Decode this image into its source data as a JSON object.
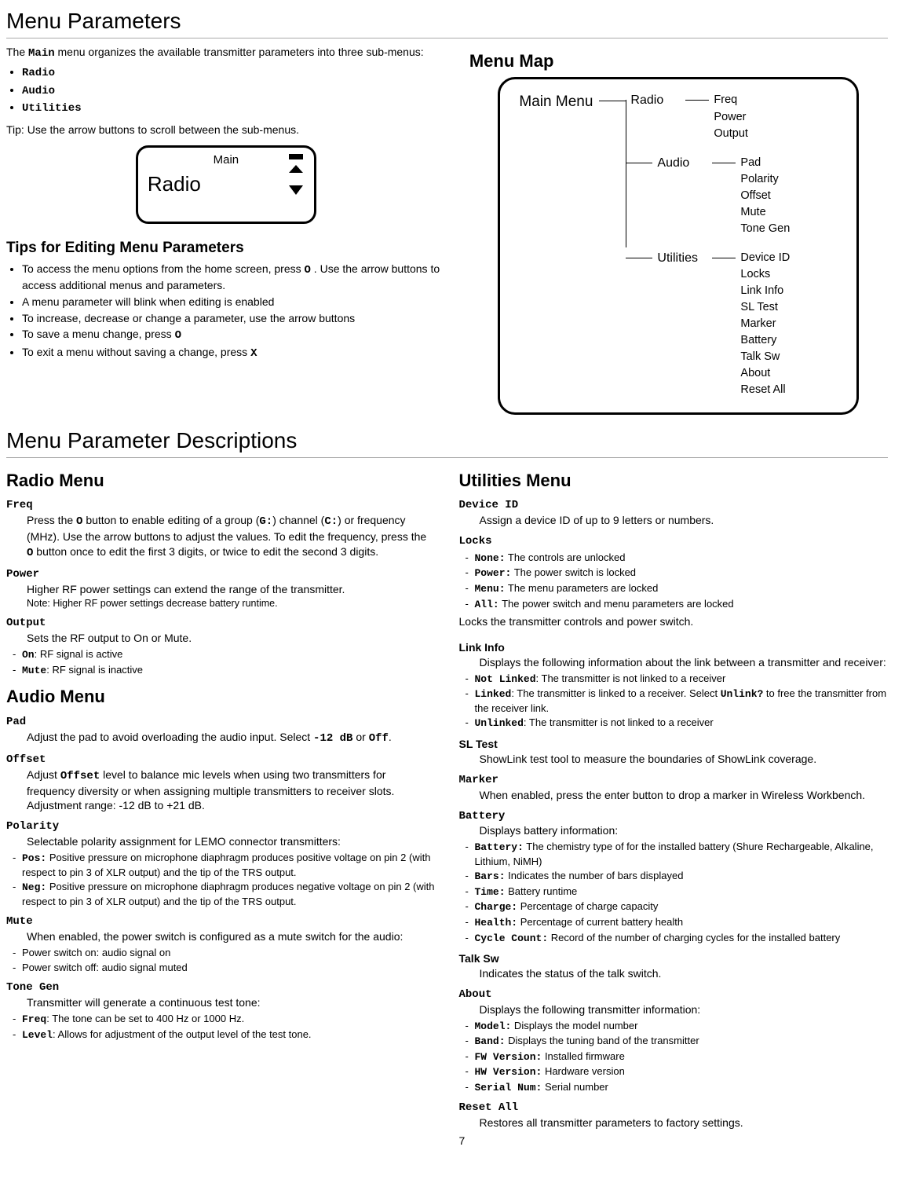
{
  "page_number": "7",
  "top": {
    "heading": "Menu Parameters",
    "intro_a": "The ",
    "intro_b": " menu organizes the available transmitter parameters into three sub-menus:",
    "main_word": "Main",
    "bullets": [
      "Radio",
      "Audio",
      "Utilities"
    ],
    "tip": "Tip: Use the arrow buttons to scroll between the sub-menus.",
    "lcd_top": "Main",
    "lcd_big": "Radio",
    "tips_heading": "Tips for Editing Menu Parameters",
    "tips": [
      {
        "a": "To access the menu options from the home screen, press ",
        "code": "O",
        "b": " . Use the arrow buttons to access additional menus and parameters."
      },
      {
        "a": "A menu parameter will blink when editing is enabled",
        "code": "",
        "b": ""
      },
      {
        "a": "To increase, decrease or change a parameter, use the arrow buttons",
        "code": "",
        "b": ""
      },
      {
        "a": "To save a menu change, press ",
        "code": "O",
        "b": ""
      },
      {
        "a": "To exit a menu without saving a change, press ",
        "code": "X",
        "b": ""
      }
    ],
    "map_heading": "Menu Map",
    "map": {
      "root": "Main Menu",
      "nodes": [
        {
          "label": "Radio",
          "items": [
            "Freq",
            "Power",
            "Output"
          ]
        },
        {
          "label": "Audio",
          "items": [
            "Pad",
            "Polarity",
            "Offset",
            "Mute",
            "Tone Gen"
          ]
        },
        {
          "label": "Utilities",
          "items": [
            "Device ID",
            "Locks",
            "Link Info",
            "SL Test",
            "Marker",
            "Battery",
            "Talk Sw",
            "About",
            "Reset All"
          ]
        }
      ]
    }
  },
  "desc_heading": "Menu Parameter Descriptions",
  "radio": {
    "heading": "Radio Menu",
    "freq_t": "Freq",
    "freq_b1": "Press the ",
    "freq_c1": "O",
    "freq_b2": " button to enable editing of a group (",
    "freq_c2": "G:",
    "freq_b3": ") channel (",
    "freq_c3": "C:",
    "freq_b4": ") or frequency (MHz). Use the arrow buttons to adjust the values. To edit the frequency, press the ",
    "freq_c4": "O",
    "freq_b5": " button once to edit the first 3 digits, or twice to edit the second 3 digits.",
    "power_t": "Power",
    "power_b": "Higher RF power settings can extend the range of the transmitter.",
    "power_note": "Note: Higher RF power settings decrease battery runtime.",
    "output_t": "Output",
    "output_b": "Sets the RF output to On or Mute.",
    "output_items": [
      {
        "c": "On",
        "t": ": RF signal is active"
      },
      {
        "c": "Mute",
        "t": ": RF signal is inactive"
      }
    ]
  },
  "audio": {
    "heading": "Audio Menu",
    "pad_t": "Pad",
    "pad_b1": "Adjust the pad to avoid overloading the audio input. Select ",
    "pad_c1": "-12 dB",
    "pad_b2": " or ",
    "pad_c2": "Off",
    "pad_b3": ".",
    "offset_t": "Offset",
    "offset_b1": "Adjust ",
    "offset_c1": "Offset",
    "offset_b2": " level to balance mic levels when using two transmitters for frequency diversity or when assigning multiple transmitters to receiver slots. Adjustment range: -12 dB to +21 dB.",
    "pol_t": "Polarity",
    "pol_b": "Selectable polarity assignment for LEMO connector transmitters:",
    "pol_items": [
      {
        "c": "Pos:",
        "t": " Positive pressure on microphone diaphragm produces positive voltage on pin 2 (with respect to pin 3 of XLR output) and the tip of the TRS output."
      },
      {
        "c": "Neg:",
        "t": " Positive pressure on microphone diaphragm produces negative voltage on pin 2 (with respect to pin 3 of XLR output) and the tip of the TRS output."
      }
    ],
    "mute_t": "Mute",
    "mute_b": "When enabled, the power switch is configured as a mute switch for the audio:",
    "mute_items": [
      {
        "c": "",
        "t": "Power switch on: audio signal on"
      },
      {
        "c": "",
        "t": "Power switch off: audio signal muted"
      }
    ],
    "tg_t": "Tone Gen",
    "tg_b": "Transmitter will generate a continuous test tone:",
    "tg_items": [
      {
        "c": "Freq",
        "t": ": The tone can be set to 400 Hz or 1000 Hz."
      },
      {
        "c": "Level",
        "t": ": Allows for adjustment of the output level of the test tone."
      }
    ]
  },
  "util": {
    "heading": "Utilities Menu",
    "dev_t": "Device ID",
    "dev_b": "Assign a device ID of up to 9 letters or numbers.",
    "locks_t": "Locks",
    "locks_items": [
      {
        "c": "None:",
        "t": " The controls are unlocked"
      },
      {
        "c": "Power:",
        "t": " The power switch is locked"
      },
      {
        "c": "Menu:",
        "t": " The menu parameters are locked"
      },
      {
        "c": "All:",
        "t": " The power switch and menu parameters are locked"
      }
    ],
    "locks_after": "Locks the transmitter controls and power switch.",
    "link_t": "Link Info",
    "link_b": "Displays the following information about the link between a transmitter and receiver:",
    "link_items": [
      {
        "c": "Not Linked",
        "t": ": The transmitter is not linked to a receiver"
      },
      {
        "c": "Linked",
        "t": ": The transmitter is linked to a receiver. Select ",
        "c2": "Unlink?",
        "t2": " to free the transmitter from the receiver link."
      },
      {
        "c": "Unlinked",
        "t": ": The transmitter is not linked to a receiver"
      }
    ],
    "sl_t": "SL Test",
    "sl_b": "ShowLink test tool to measure the boundaries of ShowLink coverage.",
    "mk_t": "Marker",
    "mk_b": "When enabled, press the enter button to drop a marker in Wireless Workbench.",
    "bat_t": "Battery",
    "bat_b": "Displays battery information:",
    "bat_items": [
      {
        "c": "Battery:",
        "t": " The chemistry type of for the installed battery (Shure Rechargeable, Alkaline, Lithium, NiMH)"
      },
      {
        "c": "Bars:",
        "t": " Indicates the number of bars displayed"
      },
      {
        "c": "Time:",
        "t": " Battery runtime"
      },
      {
        "c": "Charge:",
        "t": " Percentage of charge capacity"
      },
      {
        "c": "Health:",
        "t": " Percentage of current battery health"
      },
      {
        "c": "Cycle Count:",
        "t": " Record of the number of charging cycles for the installed battery"
      }
    ],
    "talk_t": "Talk Sw",
    "talk_b": "Indicates the status of the talk switch.",
    "about_t": "About",
    "about_b": "Displays the following transmitter information:",
    "about_items": [
      {
        "c": "Model:",
        "t": " Displays the model number"
      },
      {
        "c": "Band:",
        "t": " Displays the tuning band of the transmitter"
      },
      {
        "c": "FW Version:",
        "t": " Installed firmware"
      },
      {
        "c": "HW Version:",
        "t": " Hardware version"
      },
      {
        "c": "Serial Num:",
        "t": " Serial number"
      }
    ],
    "reset_t": "Reset All",
    "reset_b": "Restores all transmitter parameters to factory settings."
  }
}
